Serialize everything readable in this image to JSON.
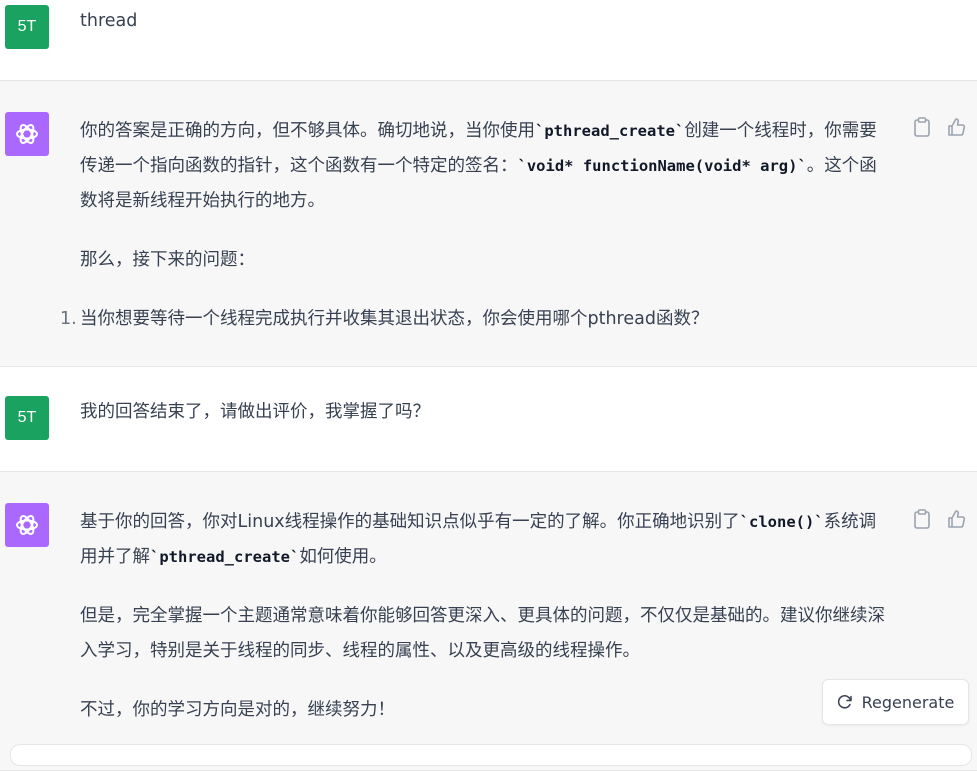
{
  "colors": {
    "user_avatar": "#1aa260",
    "bot_avatar": "#ab68ff",
    "assistant_bg": "#f7f7f8"
  },
  "messages": [
    {
      "role": "user",
      "avatar": "5T",
      "text": "thread"
    },
    {
      "role": "assistant",
      "icon": "openai-logo-icon",
      "p1": {
        "a": "你的答案是正确的方向，但不够具体。确切地说，当你使用",
        "code1": "`pthread_create`",
        "b": "创建一个线程时，你需要传递一个指向函数的指针，这个函数有一个特定的签名：",
        "code2": "`void* functionName(void* arg)`",
        "c": "。这个函数将是新线程开始执行的地方。"
      },
      "p2": "那么，接下来的问题：",
      "list_num": "1.",
      "list_item": "当你想要等待一个线程完成执行并收集其退出状态，你会使用哪个pthread函数？"
    },
    {
      "role": "user",
      "avatar": "5T",
      "text": "我的回答结束了，请做出评价，我掌握了吗？"
    },
    {
      "role": "assistant",
      "icon": "openai-logo-icon",
      "p1": {
        "a": "基于你的回答，你对Linux线程操作的基础知识点似乎有一定的了解。你正确地识别了",
        "code1": "`clone()`",
        "b": "系统调用并了解",
        "code2": "`pthread_create`",
        "c": "如何使用。"
      },
      "p2": "但是，完全掌握一个主题通常意味着你能够回答更深入、更具体的问题，不仅仅是基础的。建议你继续深入学习，特别是关于线程的同步、线程的属性、以及更高级的线程操作。",
      "p3": "不过，你的学习方向是对的，继续努力！"
    }
  ],
  "regenerate": {
    "label": "Regenerate",
    "icon": "refresh-icon"
  }
}
